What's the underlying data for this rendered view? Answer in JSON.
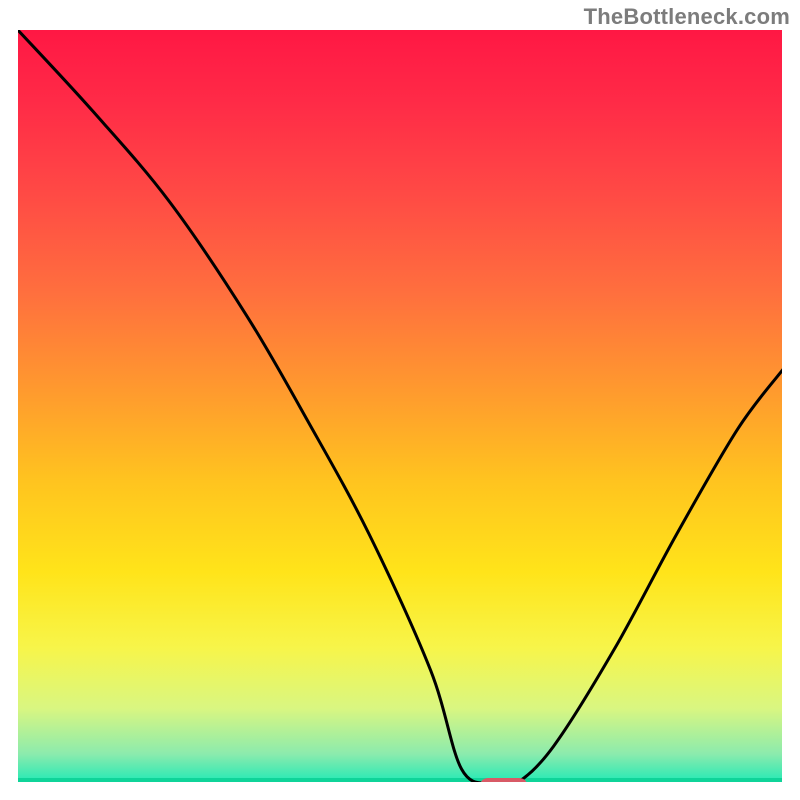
{
  "watermark": "TheBottleneck.com",
  "chart_data": {
    "type": "line",
    "title": "",
    "xlabel": "",
    "ylabel": "",
    "xlim": [
      0,
      100
    ],
    "ylim": [
      0,
      100
    ],
    "grid": false,
    "legend": false,
    "series": [
      {
        "name": "bottleneck-curve",
        "color": "#000000",
        "x": [
          0,
          10,
          20,
          30,
          38,
          46,
          54,
          58,
          62,
          65,
          70,
          78,
          86,
          94,
          100
        ],
        "values": [
          100,
          89,
          77,
          62,
          48,
          33,
          15,
          2,
          0,
          0,
          5,
          18,
          33,
          47,
          55
        ]
      }
    ],
    "background_gradient": {
      "stops": [
        {
          "offset": 0.0,
          "color": "#ff1744"
        },
        {
          "offset": 0.1,
          "color": "#ff2b47"
        },
        {
          "offset": 0.22,
          "color": "#ff4a45"
        },
        {
          "offset": 0.35,
          "color": "#ff6f3e"
        },
        {
          "offset": 0.48,
          "color": "#ff9a2e"
        },
        {
          "offset": 0.6,
          "color": "#ffc41f"
        },
        {
          "offset": 0.72,
          "color": "#ffe41a"
        },
        {
          "offset": 0.82,
          "color": "#f7f54a"
        },
        {
          "offset": 0.9,
          "color": "#d9f681"
        },
        {
          "offset": 0.96,
          "color": "#8cebad"
        },
        {
          "offset": 1.0,
          "color": "#1de9b6"
        }
      ]
    },
    "marker": {
      "x_center": 63.5,
      "y_center": 0,
      "width": 6.0,
      "height": 1.6,
      "rx": 1.0,
      "color": "#d85a66"
    },
    "baseline": {
      "y": 0,
      "color": "#0fd499",
      "thickness_px": 6
    },
    "frame_color": "#ffffff"
  }
}
